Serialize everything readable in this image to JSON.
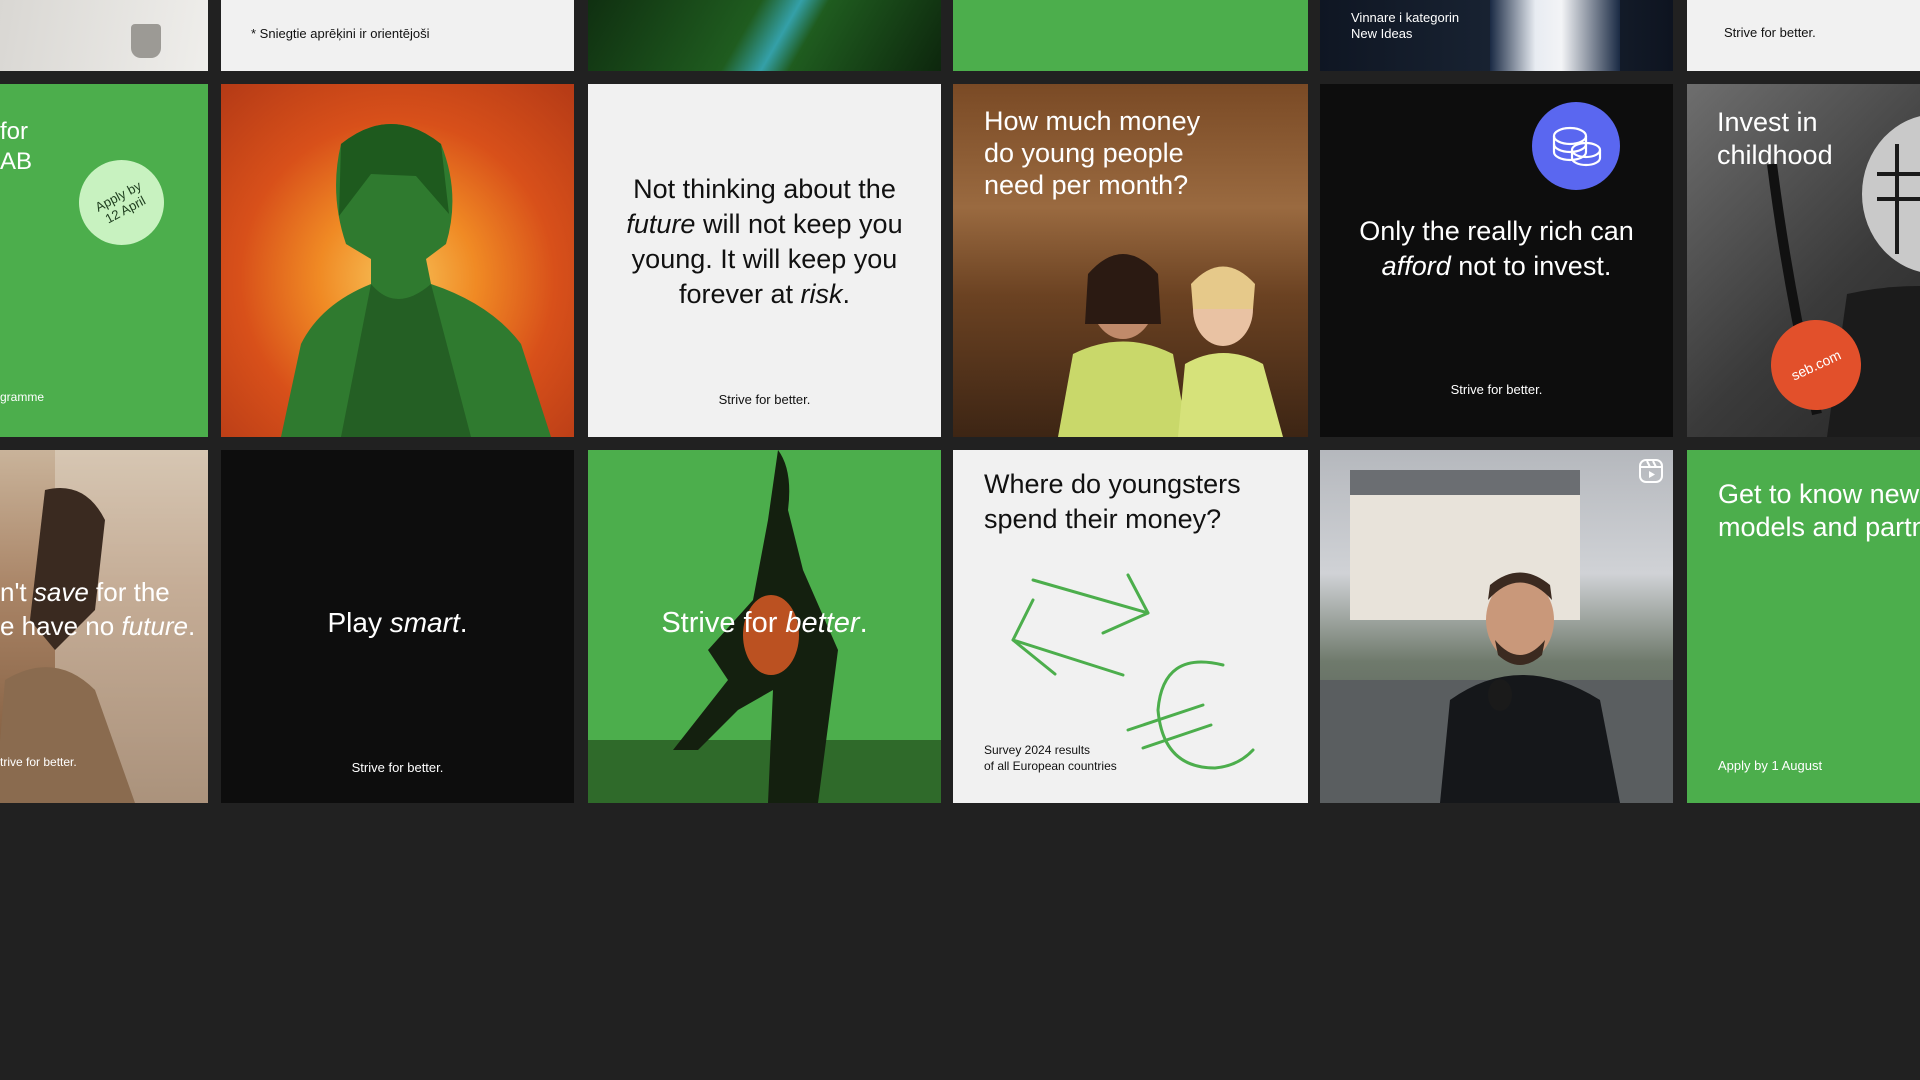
{
  "row0": {
    "latvian_note": "* Sniegtie aprēķini ir orientējoši",
    "award": [
      "Vinnare i kategorin",
      "New Ideas"
    ],
    "slogan": "Strive for better."
  },
  "tile_apply": {
    "title_lines": [
      "for",
      "AB"
    ],
    "badge": [
      "Apply by",
      "12 April"
    ],
    "footer": "gramme"
  },
  "tile_future": {
    "pre": "Not thinking about the",
    "future": "future",
    "mid": "will not keep you young. It will keep you forever at",
    "risk": "risk",
    "end": ".",
    "footer": "Strive for better."
  },
  "tile_money": {
    "question": "How much money do young people need per month?"
  },
  "tile_rich": {
    "pre": "Only the really rich can",
    "afford": "afford",
    "post": "not to invest.",
    "footer": "Strive for better.",
    "coin_icon": "coins-icon"
  },
  "tile_childhood": {
    "title": "Invest in childhood",
    "badge": "seb.com"
  },
  "tile_save": {
    "line1_a": "n't",
    "line1_save": "save",
    "line1_b": "for the",
    "line2_a": "e have no",
    "line2_future": "future",
    "line2_b": ".",
    "footer": "trive for better."
  },
  "tile_play": {
    "a": "Play",
    "smart": "smart",
    "b": ".",
    "footer": "Strive for better."
  },
  "tile_strive": {
    "a": "Strive for",
    "better": "better",
    "b": "."
  },
  "tile_youngsters": {
    "question": "Where do youngsters spend their money?",
    "caption": [
      "Survey 2024 results",
      "of all European countries"
    ]
  },
  "tile_video": {
    "reel_icon": "reel-icon"
  },
  "tile_business": {
    "title": "Get to know new business models and partners",
    "footer": "Apply by 1 August"
  },
  "colors": {
    "green": "#4cae4c",
    "light_green": "#c8f2c0",
    "blue_badge": "#5a67f0",
    "orange_badge": "#e2502b",
    "background": "#212121"
  }
}
